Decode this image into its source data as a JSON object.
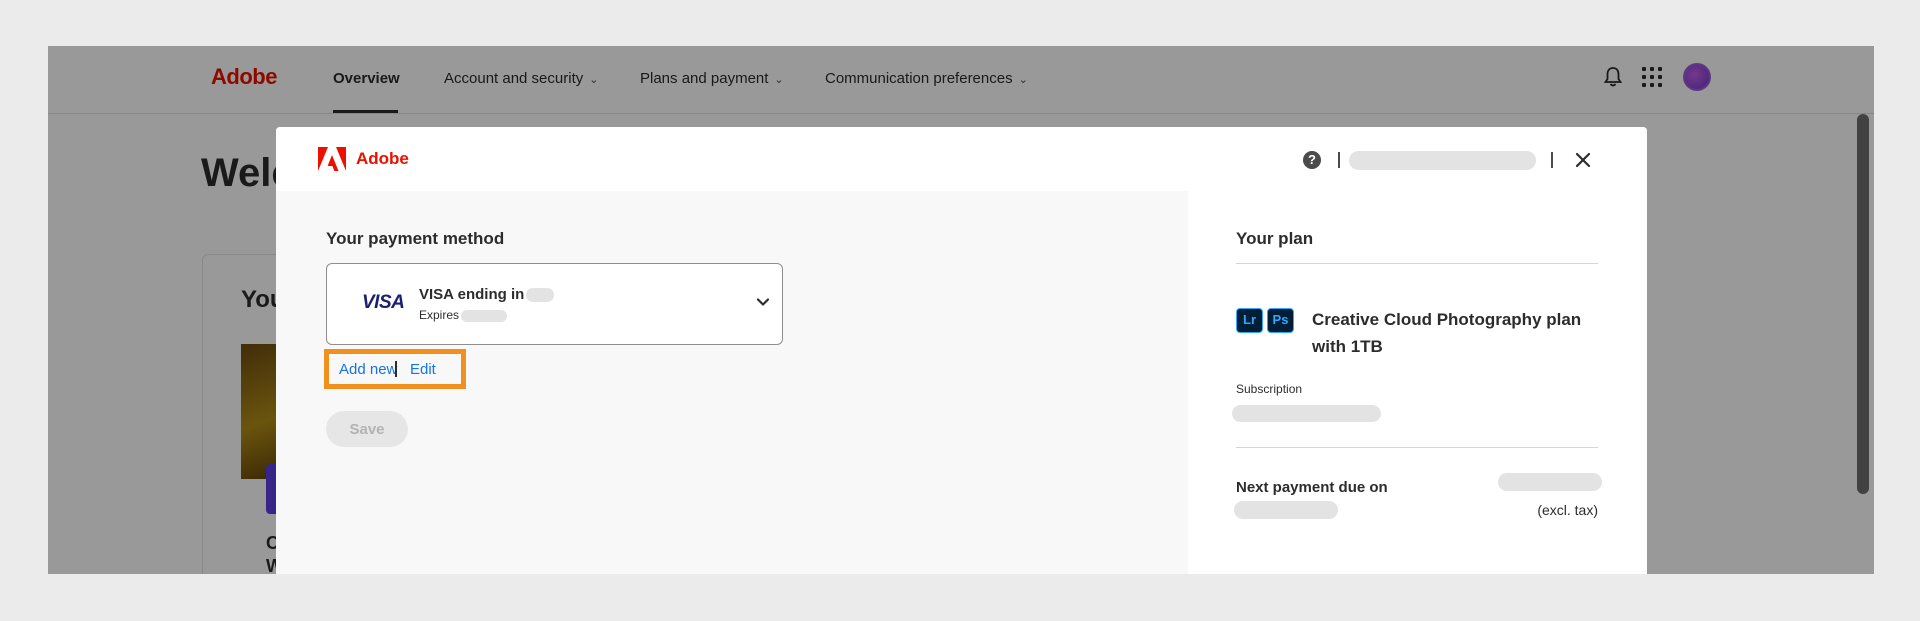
{
  "page": {
    "brand": "Adobe",
    "nav": [
      {
        "label": "Overview"
      },
      {
        "label": "Account and security"
      },
      {
        "label": "Plans and payment"
      },
      {
        "label": "Communication preferences"
      }
    ],
    "welcome_partial": "Welc",
    "card_title_partial": "You",
    "item_partial_1": "C",
    "item_partial_2": "W"
  },
  "modal": {
    "brand": "Adobe",
    "help_glyph": "?",
    "close_glyph": "×",
    "payment": {
      "title": "Your payment method",
      "card_brand": "VISA",
      "card_line": "VISA ending in",
      "expires_label": "Expires",
      "add_new": "Add new",
      "edit": "Edit",
      "save": "Save"
    },
    "plan": {
      "title": "Your plan",
      "app_badges": [
        "Lr",
        "Ps"
      ],
      "name": "Creative Cloud Photography plan with 1TB",
      "subscription_label": "Subscription",
      "next_payment_label": "Next payment due on",
      "tax_note": "(excl. tax)"
    }
  },
  "colors": {
    "brand_red": "#eb1000",
    "link_blue": "#1473e6",
    "highlight_orange": "#f0901e",
    "visa_navy": "#1a1f71",
    "adobe_app_blue": "#31a8ff"
  }
}
